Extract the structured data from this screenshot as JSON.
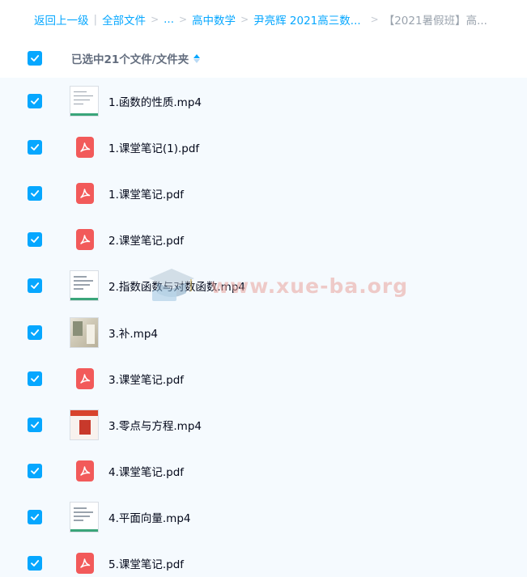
{
  "breadcrumb": {
    "back": "返回上一级",
    "all_files": "全部文件",
    "ellipsis": "...",
    "level1": "高中数学",
    "level2": "尹亮辉 2021高三数...",
    "current": "【2021暑假班】高..."
  },
  "header": {
    "label": "已选中21个文件/文件夹",
    "sort_icon": "sort-arrows-icon"
  },
  "files": [
    {
      "name": "1.函数的性质.mp4",
      "type": "video",
      "thumb": "doc"
    },
    {
      "name": "1.课堂笔记(1).pdf",
      "type": "pdf"
    },
    {
      "name": "1.课堂笔记.pdf",
      "type": "pdf"
    },
    {
      "name": "2.课堂笔记.pdf",
      "type": "pdf"
    },
    {
      "name": "2.指数函数与对数函数.mp4",
      "type": "video",
      "thumb": "doc"
    },
    {
      "name": "3.补.mp4",
      "type": "video",
      "thumb": "photo"
    },
    {
      "name": "3.课堂笔记.pdf",
      "type": "pdf"
    },
    {
      "name": "3.零点与方程.mp4",
      "type": "video",
      "thumb": "red"
    },
    {
      "name": "4.课堂笔记.pdf",
      "type": "pdf"
    },
    {
      "name": "4.平面向量.mp4",
      "type": "video",
      "thumb": "doc"
    },
    {
      "name": "5.课堂笔记.pdf",
      "type": "pdf"
    }
  ],
  "watermark": {
    "text": "www.xue-ba.org"
  },
  "colors": {
    "accent": "#06a7ff",
    "pdf": "#f25a5a",
    "row_bg": "#f5fafe"
  }
}
